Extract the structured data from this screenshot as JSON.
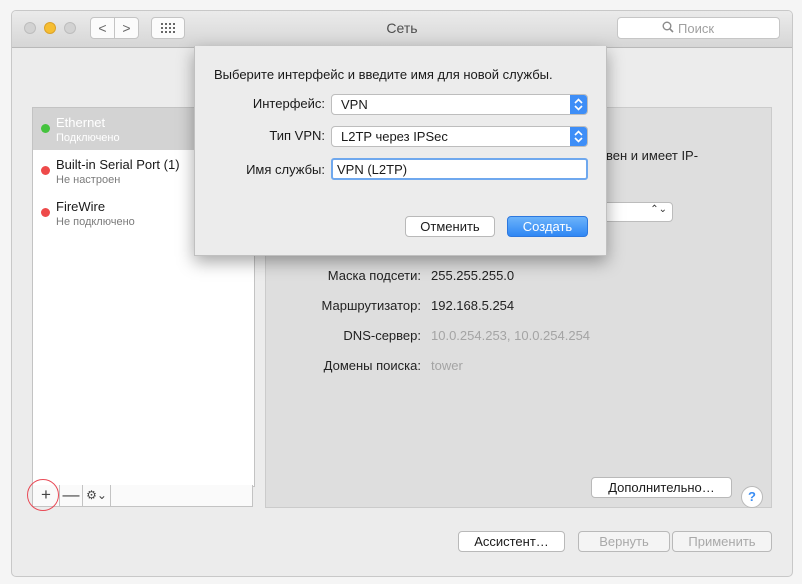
{
  "window": {
    "title": "Сеть"
  },
  "toolbar": {
    "back": "<",
    "forward": ">",
    "search_placeholder": "Поиск"
  },
  "services": [
    {
      "name": "Ethernet",
      "status": "Подключено",
      "color": "#45c33e"
    },
    {
      "name": "Built-in Serial Port (1)",
      "status": "Не настроен",
      "color": "#ee4a4a"
    },
    {
      "name": "FireWire",
      "status": "Не подключено",
      "color": "#ee4a4a"
    }
  ],
  "sidebar_bar": {
    "add": "+",
    "remove": "—",
    "gear": "⚙⌄"
  },
  "detail": {
    "partial_text": "вен и имеет IP-",
    "rows": [
      {
        "label": "Маска подсети:",
        "value": "255.255.255.0"
      },
      {
        "label": "Маршрутизатор:",
        "value": "192.168.5.254"
      },
      {
        "label": "DNS-сервер:",
        "value": "10.0.254.253, 10.0.254.254"
      },
      {
        "label": "Домены поиска:",
        "value": "tower"
      }
    ],
    "advanced_button": "Дополнительно…",
    "help": "?"
  },
  "footer": {
    "assistant": "Ассистент…",
    "revert": "Вернуть",
    "apply": "Применить"
  },
  "sheet": {
    "prompt": "Выберите интерфейс и введите имя для новой службы.",
    "interface_label": "Интерфейс:",
    "interface_value": "VPN",
    "vpn_type_label": "Тип VPN:",
    "vpn_type_value": "L2TP через IPSec",
    "service_name_label": "Имя службы:",
    "service_name_value": "VPN (L2TP)",
    "cancel": "Отменить",
    "create": "Создать"
  },
  "colors": {
    "accent": "#3e8ef7",
    "connected": "#45c33e",
    "disconnected": "#ee4a4a",
    "highlight_ring": "#e94a56"
  }
}
